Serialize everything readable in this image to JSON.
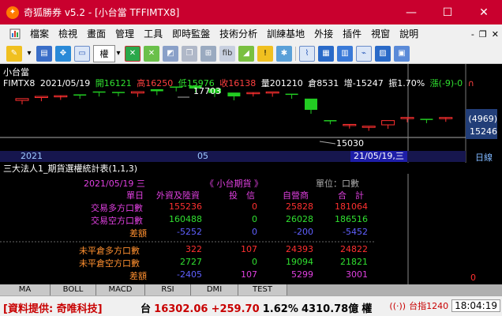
{
  "window": {
    "title": "奇狐勝券 v5.2 - [小台當 TFFIMTX8]",
    "icon": "fox-icon"
  },
  "menu": {
    "items": [
      "檔案",
      "檢視",
      "畫面",
      "管理",
      "工具",
      "即時監盤",
      "技術分析",
      "訓練基地",
      "外接",
      "插件",
      "視窗",
      "說明"
    ],
    "right_min": "-",
    "right_restore": "❐",
    "right_close": "✕"
  },
  "toolbar": {
    "quan_label": "權",
    "icons": [
      "pencil-icon",
      "save-icon",
      "move-icon",
      "layout-icon",
      "quan-select",
      "chart-red-icon",
      "chart-green-icon",
      "drawing-icon",
      "copy-icon",
      "grid-icon",
      "fib-icon",
      "eraser-icon",
      "warning-icon",
      "tools-icon",
      "chart-view-1-icon",
      "chart-view-2-icon",
      "chart-view-3-icon",
      "chart-view-4-icon",
      "chart-view-5-icon",
      "chart-view-6-icon"
    ]
  },
  "chart": {
    "symbol_title": "小台當",
    "ohlc": {
      "code": "FIMTX8",
      "date": "2021/05/19",
      "open": "開16121",
      "high": "高16250",
      "low": "低15976",
      "close": "收16138",
      "volume": "量201210",
      "oi": "倉8531",
      "oi_change": "增-15247",
      "amplitude": "振1.70%",
      "change": "漲(-9)-0",
      "end_mark": "∩"
    },
    "annotations": {
      "high_label": "17703",
      "low_label": "15030"
    },
    "yaxis": {
      "badge": "(4969)",
      "last": "15246"
    },
    "xaxis": {
      "y2021": "2021",
      "m05": "05",
      "cursor_date": "21/05/19,三",
      "period": "日線"
    },
    "colors": {
      "up": "#ff3030",
      "down": "#22cc22"
    },
    "chart_data": {
      "type": "candlestick",
      "title": "小台當",
      "series": [
        {
          "name": "FIMTX8",
          "candles": [
            {
              "o": 16900,
              "c": 16980
            },
            {
              "o": 17040,
              "c": 17080
            },
            {
              "o": 17100,
              "c": 17110
            },
            {
              "o": 17170,
              "c": 17150
            },
            {
              "o": 17300,
              "c": 17250
            },
            {
              "o": 17280,
              "c": 17260
            },
            {
              "o": 17230,
              "c": 17290
            },
            {
              "o": 17400,
              "c": 17310
            },
            {
              "o": 17520,
              "c": 17480
            },
            {
              "o": 17560,
              "c": 17430
            },
            {
              "o": 17430,
              "c": 17230
            },
            {
              "o": 17250,
              "c": 17080
            },
            {
              "o": 17250,
              "c": 17250
            },
            {
              "o": 17240,
              "c": 17280
            },
            {
              "o": 17200,
              "c": 17150
            },
            {
              "o": 16980,
              "c": 16480
            },
            {
              "o": 16020,
              "c": 16010
            },
            {
              "o": 15820,
              "c": 15830
            },
            {
              "o": 15720,
              "c": 15750
            },
            {
              "o": 15810,
              "c": 16000
            },
            {
              "o": 16100,
              "c": 16140
            },
            {
              "o": 16080,
              "c": 16060
            },
            {
              "o": 16121,
              "c": 16138
            }
          ]
        }
      ]
    }
  },
  "panel": {
    "title": "三大法人1_期貨選權統計表(1,1,3)",
    "date": "2021/05/19 三",
    "product": "《 小台期貨 》",
    "unit": "單位：口數",
    "col_unit_label": "單日",
    "headers": [
      "外資及陸資",
      "投　信",
      "自營商",
      "合　計"
    ],
    "rows": [
      {
        "label": "交易多方口數",
        "values": [
          "155236",
          "0",
          "25828",
          "181064"
        ]
      },
      {
        "label": "交易空方口數",
        "values": [
          "160488",
          "0",
          "26028",
          "186516"
        ]
      },
      {
        "label": "差額",
        "values": [
          "-5252",
          "0",
          "-200",
          "-5452"
        ]
      },
      {
        "label": "未平倉多方口數",
        "values": [
          "322",
          "107",
          "24393",
          "24822"
        ]
      },
      {
        "label": "未平倉空方口數",
        "values": [
          "2727",
          "0",
          "19094",
          "21821"
        ]
      },
      {
        "label": "差額",
        "values": [
          "-2405",
          "107",
          "5299",
          "3001"
        ]
      }
    ],
    "side_value": "0"
  },
  "bottom_tabs": [
    "MA",
    "BOLL",
    "MACD",
    "RSI",
    "DMI",
    "TEST"
  ],
  "status": {
    "provider": "[資料提供: 奇唯科技]",
    "index_label": "台",
    "index_value": "16302.06",
    "index_change": "+259.70",
    "index_pct": "1.62%",
    "index_volume": "4310.78億",
    "quan": "權",
    "other": "台指1240",
    "time": "18:04:19"
  }
}
